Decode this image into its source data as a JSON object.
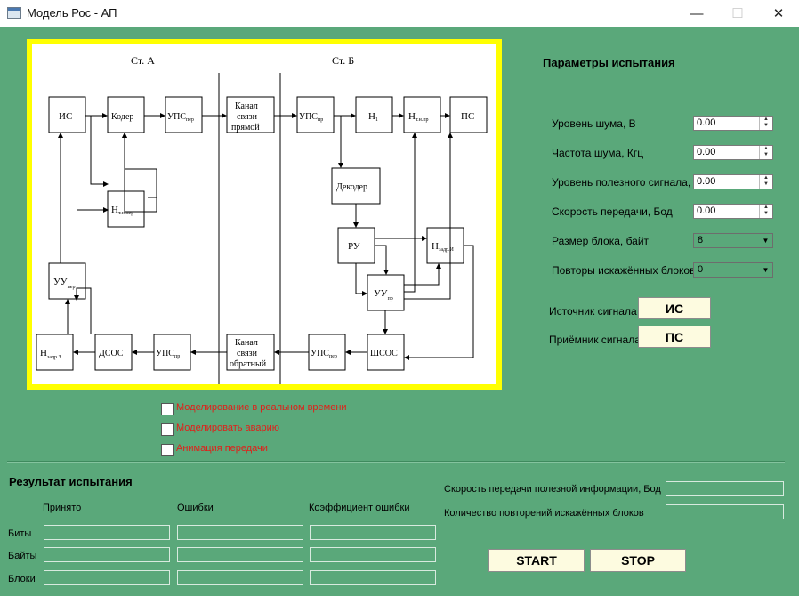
{
  "window": {
    "title": "Модель Рос - АП",
    "minimize": "—",
    "maximize": "☐",
    "close": "✕"
  },
  "diagram": {
    "stations": {
      "a": "Ст. А",
      "b": "Ст. Б"
    },
    "blocks": {
      "is": "ИС",
      "koder": "Кодер",
      "ups_per_main": "УПС",
      "ups_per_sub": "пер",
      "chan_fwd_1": "Канал",
      "chan_fwd_2": "связи",
      "chan_fwd_3": "прямой",
      "ups_pr_b_main": "УПС",
      "ups_pr_b_sub": "пр",
      "n1_main": "Н",
      "n1_sub": "1",
      "ntnpr_main": "Н",
      "ntnpr_sub": "т.н.пр",
      "ps": "ПС",
      "ntnper_main": "Н",
      "ntnper_sub": "т.н.пер",
      "dekoder": "Декодер",
      "ru": "РУ",
      "nzadri_main": "Н",
      "nzadri_sub": "задр.И",
      "uu_per_main": "УУ",
      "uu_per_sub": "пер",
      "uu_pr_main": "УУ",
      "uu_pr_sub": "пр",
      "nzadrz_main": "Н",
      "nzadrz_sub": "задр.З",
      "dsos": "ДСОС",
      "ups_pr_a_main": "УПС",
      "ups_pr_a_sub": "пр",
      "chan_back_1": "Канал",
      "chan_back_2": "связи",
      "chan_back_3": "обратный",
      "ups_per_b_main": "УПС",
      "ups_per_b_sub": "пер",
      "shsos": "ШСОС"
    }
  },
  "params": {
    "title": "Параметры испытания",
    "noise_level": {
      "label": "Уровень шума, В",
      "value": "0.00"
    },
    "noise_freq": {
      "label": "Частота шума, Кгц",
      "value": "0.00"
    },
    "signal_level": {
      "label": "Уровень полезного сигнала, В",
      "value": "0.00"
    },
    "speed": {
      "label": "Скорость передачи, Бод",
      "value": "0.00"
    },
    "block_size": {
      "label": "Размер блока, байт",
      "value": "8"
    },
    "repeats": {
      "label": "Повторы искажённых блоков",
      "value": "0"
    },
    "source": {
      "label": "Источник сигнала",
      "button": "ИС"
    },
    "receiver": {
      "label": "Приёмник сигнала",
      "button": "ПС"
    }
  },
  "options": {
    "realtime": "Моделирование в реальном времени",
    "accident": "Моделировать аварию",
    "animation": "Анимация передачи"
  },
  "results": {
    "title": "Результат испытания",
    "col_received": "Принято",
    "col_errors": "Ошибки",
    "col_coef": "Коэффициент ошибки",
    "row_bits": "Биты",
    "row_bytes": "Байты",
    "row_blocks": "Блоки",
    "useful_speed_label": "Скорость передачи полезной информации, Бод",
    "repeat_count_label": "Количество повторений искажённых блоков"
  },
  "controls": {
    "start": "START",
    "stop": "STOP"
  }
}
